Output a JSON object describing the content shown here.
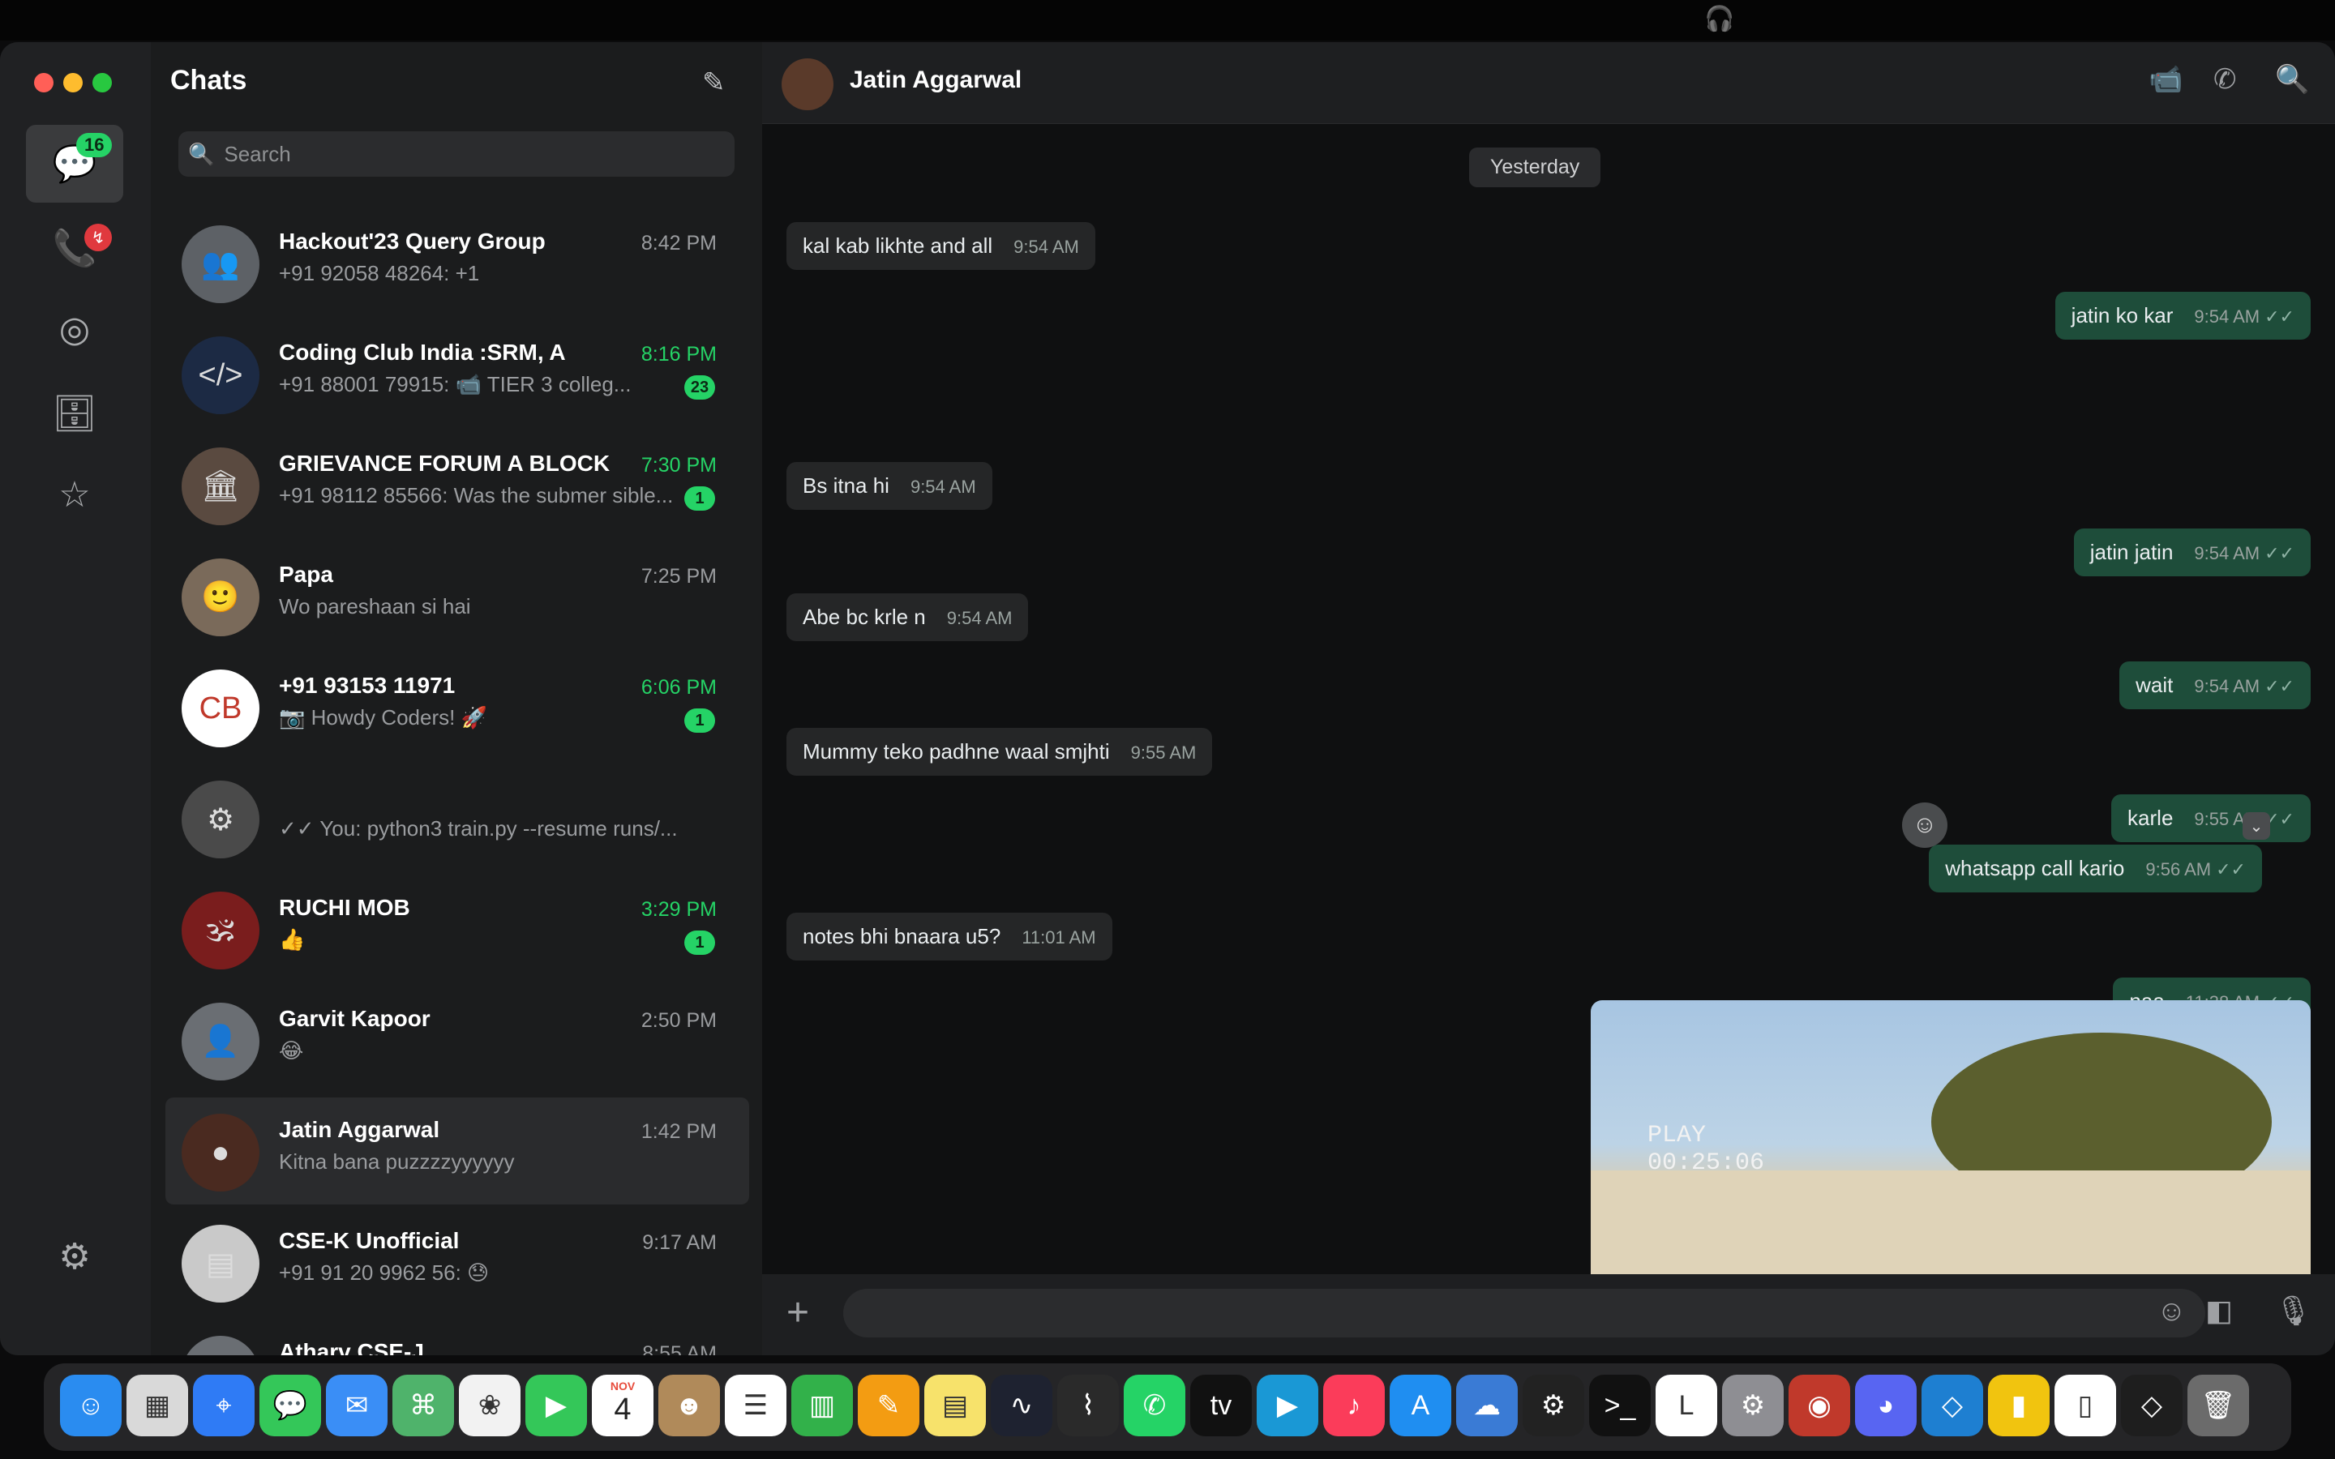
{
  "menubar": {
    "apple_icon": "apple-logo-icon",
    "headphones_icon": "headphones-icon"
  },
  "rail": {
    "chats_badge": "16",
    "calls_badge_icon": "missed-call-badge-icon",
    "icons": [
      "chats-icon",
      "calls-icon",
      "status-icon",
      "archive-icon",
      "starred-icon",
      "settings-icon"
    ]
  },
  "list": {
    "title": "Chats",
    "search_placeholder": "Search",
    "chats": [
      {
        "name": "Hackout'23 Query Group",
        "msg": "+91 92058 48264: +1",
        "time": "8:42 PM",
        "unread": "",
        "green": false,
        "avatar": "group"
      },
      {
        "name": "Coding Club India :SRM, A",
        "msg": "+91 88001 79915: 📹 TIER 3 colleg...",
        "time": "8:16 PM",
        "unread": "23",
        "green": true,
        "avatar": "cc"
      },
      {
        "name": "GRIEVANCE FORUM A BLOCK",
        "msg": "+91 98112 85566: Was the submer sible...",
        "time": "7:30 PM",
        "unread": "1",
        "green": true,
        "avatar": "bldg"
      },
      {
        "name": "Papa",
        "msg": "Wo pareshaan si hai",
        "time": "7:25 PM",
        "unread": "",
        "green": false,
        "avatar": "papa"
      },
      {
        "name": "+91 93153 11971",
        "msg": "📷 Howdy Coders! 🚀",
        "time": "6:06 PM",
        "unread": "1",
        "green": true,
        "avatar": "cb"
      },
      {
        "name": "",
        "msg": "✓✓ You: python3 train.py --resume runs/...",
        "time": "",
        "unread": "",
        "green": false,
        "avatar": "gen"
      },
      {
        "name": "RUCHI MOB",
        "msg": "👍",
        "time": "3:29 PM",
        "unread": "1",
        "green": true,
        "avatar": "red"
      },
      {
        "name": "Garvit Kapoor",
        "msg": "😂",
        "time": "2:50 PM",
        "unread": "",
        "green": false,
        "avatar": "person"
      },
      {
        "name": "Jatin Aggarwal",
        "msg": "Kitna bana puzzzzyyyyyy",
        "time": "1:42 PM",
        "unread": "",
        "green": false,
        "avatar": "jatin"
      },
      {
        "name": "CSE-K Unofficial",
        "msg": "+91 91 20 9962 56: 😓",
        "time": "9:17 AM",
        "unread": "",
        "green": false,
        "avatar": "doc"
      },
      {
        "name": "Atharv CSE-J",
        "msg": "",
        "time": "8:55 AM",
        "unread": "",
        "green": false,
        "avatar": "person"
      }
    ]
  },
  "conversation": {
    "contact_name": "Jatin Aggarwal",
    "date_label": "Yesterday",
    "messages": [
      {
        "dir": "in",
        "text": "kal kab likhte and all",
        "time": "9:54 AM"
      },
      {
        "dir": "out",
        "text": "jatin ko kar",
        "time": "9:54 AM"
      },
      {
        "dir": "in",
        "text": "Bs itna hi",
        "time": "9:54 AM"
      },
      {
        "dir": "out",
        "text": "jatin jatin",
        "time": "9:54 AM"
      },
      {
        "dir": "in",
        "text": "Abe bc krle n",
        "time": "9:54 AM"
      },
      {
        "dir": "out",
        "text": "wait",
        "time": "9:54 AM"
      },
      {
        "dir": "in",
        "text": "Mummy teko padhne waal smjhti",
        "time": "9:55 AM"
      },
      {
        "dir": "out",
        "text": "karle",
        "time": "9:55 AM"
      },
      {
        "dir": "out",
        "text": "whatsapp call kario",
        "time": "9:56 AM"
      },
      {
        "dir": "in",
        "text": "notes bhi bnaara u5?",
        "time": "11:01 AM"
      },
      {
        "dir": "out",
        "text": "naa",
        "time": "11:38 AM"
      }
    ],
    "video_overlay": "PLAY\n00:25:06"
  },
  "dock": {
    "apps": [
      "finder",
      "launchpad",
      "safari",
      "messages",
      "mail",
      "maps",
      "photos",
      "facetime",
      "calendar",
      "contacts",
      "reminders",
      "numbers",
      "pages",
      "notes",
      "freeform",
      "stocks",
      "whatsapp",
      "tv",
      "prime-video",
      "music",
      "app-store",
      "weather",
      "settings-alt",
      "terminal",
      "logi",
      "system-settings",
      "photo-booth",
      "discord",
      "vscode",
      "ticket",
      "preview",
      "code-small",
      "trash"
    ],
    "calendar_month": "NOV",
    "calendar_day": "4"
  }
}
